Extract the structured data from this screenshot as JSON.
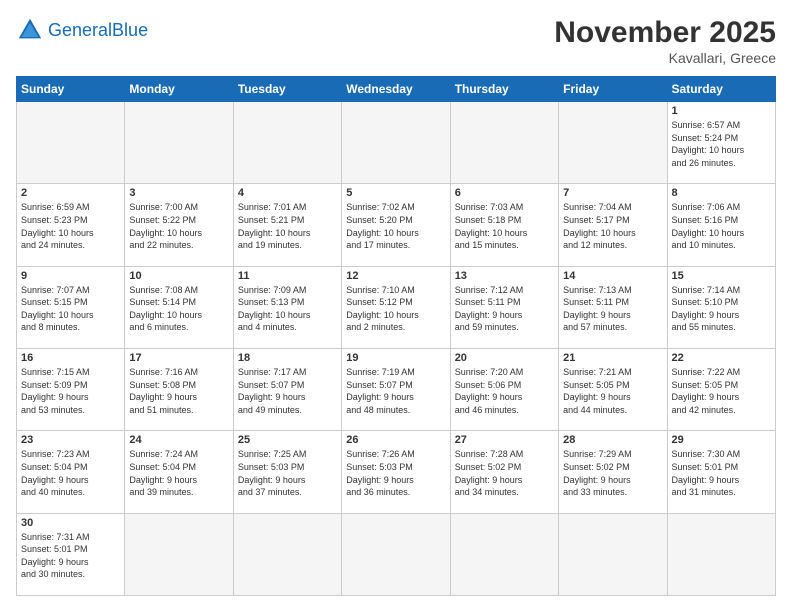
{
  "header": {
    "logo_general": "General",
    "logo_blue": "Blue",
    "month_year": "November 2025",
    "location": "Kavallari, Greece"
  },
  "weekdays": [
    "Sunday",
    "Monday",
    "Tuesday",
    "Wednesday",
    "Thursday",
    "Friday",
    "Saturday"
  ],
  "weeks": [
    [
      {
        "day": "",
        "info": ""
      },
      {
        "day": "",
        "info": ""
      },
      {
        "day": "",
        "info": ""
      },
      {
        "day": "",
        "info": ""
      },
      {
        "day": "",
        "info": ""
      },
      {
        "day": "",
        "info": ""
      },
      {
        "day": "1",
        "info": "Sunrise: 6:57 AM\nSunset: 5:24 PM\nDaylight: 10 hours\nand 26 minutes."
      }
    ],
    [
      {
        "day": "2",
        "info": "Sunrise: 6:59 AM\nSunset: 5:23 PM\nDaylight: 10 hours\nand 24 minutes."
      },
      {
        "day": "3",
        "info": "Sunrise: 7:00 AM\nSunset: 5:22 PM\nDaylight: 10 hours\nand 22 minutes."
      },
      {
        "day": "4",
        "info": "Sunrise: 7:01 AM\nSunset: 5:21 PM\nDaylight: 10 hours\nand 19 minutes."
      },
      {
        "day": "5",
        "info": "Sunrise: 7:02 AM\nSunset: 5:20 PM\nDaylight: 10 hours\nand 17 minutes."
      },
      {
        "day": "6",
        "info": "Sunrise: 7:03 AM\nSunset: 5:18 PM\nDaylight: 10 hours\nand 15 minutes."
      },
      {
        "day": "7",
        "info": "Sunrise: 7:04 AM\nSunset: 5:17 PM\nDaylight: 10 hours\nand 12 minutes."
      },
      {
        "day": "8",
        "info": "Sunrise: 7:06 AM\nSunset: 5:16 PM\nDaylight: 10 hours\nand 10 minutes."
      }
    ],
    [
      {
        "day": "9",
        "info": "Sunrise: 7:07 AM\nSunset: 5:15 PM\nDaylight: 10 hours\nand 8 minutes."
      },
      {
        "day": "10",
        "info": "Sunrise: 7:08 AM\nSunset: 5:14 PM\nDaylight: 10 hours\nand 6 minutes."
      },
      {
        "day": "11",
        "info": "Sunrise: 7:09 AM\nSunset: 5:13 PM\nDaylight: 10 hours\nand 4 minutes."
      },
      {
        "day": "12",
        "info": "Sunrise: 7:10 AM\nSunset: 5:12 PM\nDaylight: 10 hours\nand 2 minutes."
      },
      {
        "day": "13",
        "info": "Sunrise: 7:12 AM\nSunset: 5:11 PM\nDaylight: 9 hours\nand 59 minutes."
      },
      {
        "day": "14",
        "info": "Sunrise: 7:13 AM\nSunset: 5:11 PM\nDaylight: 9 hours\nand 57 minutes."
      },
      {
        "day": "15",
        "info": "Sunrise: 7:14 AM\nSunset: 5:10 PM\nDaylight: 9 hours\nand 55 minutes."
      }
    ],
    [
      {
        "day": "16",
        "info": "Sunrise: 7:15 AM\nSunset: 5:09 PM\nDaylight: 9 hours\nand 53 minutes."
      },
      {
        "day": "17",
        "info": "Sunrise: 7:16 AM\nSunset: 5:08 PM\nDaylight: 9 hours\nand 51 minutes."
      },
      {
        "day": "18",
        "info": "Sunrise: 7:17 AM\nSunset: 5:07 PM\nDaylight: 9 hours\nand 49 minutes."
      },
      {
        "day": "19",
        "info": "Sunrise: 7:19 AM\nSunset: 5:07 PM\nDaylight: 9 hours\nand 48 minutes."
      },
      {
        "day": "20",
        "info": "Sunrise: 7:20 AM\nSunset: 5:06 PM\nDaylight: 9 hours\nand 46 minutes."
      },
      {
        "day": "21",
        "info": "Sunrise: 7:21 AM\nSunset: 5:05 PM\nDaylight: 9 hours\nand 44 minutes."
      },
      {
        "day": "22",
        "info": "Sunrise: 7:22 AM\nSunset: 5:05 PM\nDaylight: 9 hours\nand 42 minutes."
      }
    ],
    [
      {
        "day": "23",
        "info": "Sunrise: 7:23 AM\nSunset: 5:04 PM\nDaylight: 9 hours\nand 40 minutes."
      },
      {
        "day": "24",
        "info": "Sunrise: 7:24 AM\nSunset: 5:04 PM\nDaylight: 9 hours\nand 39 minutes."
      },
      {
        "day": "25",
        "info": "Sunrise: 7:25 AM\nSunset: 5:03 PM\nDaylight: 9 hours\nand 37 minutes."
      },
      {
        "day": "26",
        "info": "Sunrise: 7:26 AM\nSunset: 5:03 PM\nDaylight: 9 hours\nand 36 minutes."
      },
      {
        "day": "27",
        "info": "Sunrise: 7:28 AM\nSunset: 5:02 PM\nDaylight: 9 hours\nand 34 minutes."
      },
      {
        "day": "28",
        "info": "Sunrise: 7:29 AM\nSunset: 5:02 PM\nDaylight: 9 hours\nand 33 minutes."
      },
      {
        "day": "29",
        "info": "Sunrise: 7:30 AM\nSunset: 5:01 PM\nDaylight: 9 hours\nand 31 minutes."
      }
    ],
    [
      {
        "day": "30",
        "info": "Sunrise: 7:31 AM\nSunset: 5:01 PM\nDaylight: 9 hours\nand 30 minutes."
      },
      {
        "day": "",
        "info": ""
      },
      {
        "day": "",
        "info": ""
      },
      {
        "day": "",
        "info": ""
      },
      {
        "day": "",
        "info": ""
      },
      {
        "day": "",
        "info": ""
      },
      {
        "day": "",
        "info": ""
      }
    ]
  ]
}
